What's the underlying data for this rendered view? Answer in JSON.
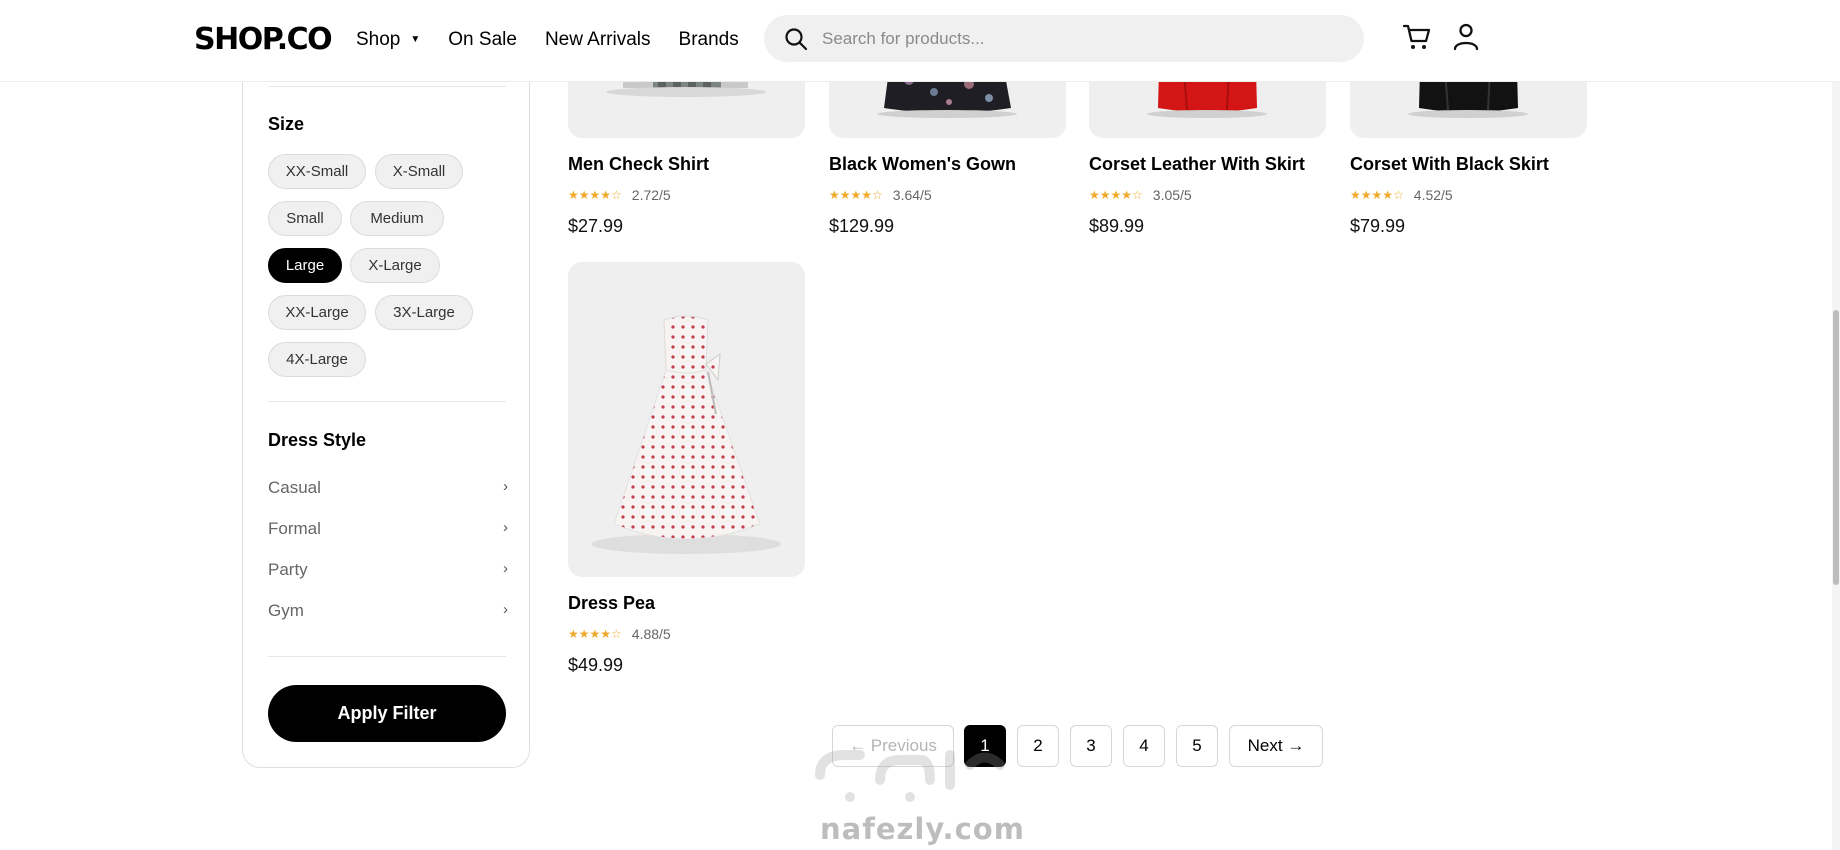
{
  "header": {
    "logo": "SHOP.CO",
    "nav": [
      {
        "label": "Shop",
        "has_dropdown": true
      },
      {
        "label": "On Sale"
      },
      {
        "label": "New Arrivals"
      },
      {
        "label": "Brands"
      }
    ],
    "search_placeholder": "Search for products..."
  },
  "filters": {
    "size_title": "Size",
    "sizes": [
      "XX-Small",
      "X-Small",
      "Small",
      "Medium",
      "Large",
      "X-Large",
      "XX-Large",
      "3X-Large",
      "4X-Large"
    ],
    "selected_size": "Large",
    "dress_style_title": "Dress Style",
    "dress_styles": [
      "Casual",
      "Formal",
      "Party",
      "Gym"
    ],
    "chevron": "›",
    "apply_label": "Apply Filter"
  },
  "products": [
    {
      "name": "Men Check Shirt",
      "rating": "2.72/5",
      "stars": "★★★★☆",
      "price": "$27.99"
    },
    {
      "name": "Black Women's Gown",
      "rating": "3.64/5",
      "stars": "★★★★☆",
      "price": "$129.99"
    },
    {
      "name": "Corset Leather With Skirt",
      "rating": "3.05/5",
      "stars": "★★★★☆",
      "price": "$89.99"
    },
    {
      "name": "Corset With Black Skirt",
      "rating": "4.52/5",
      "stars": "★★★★☆",
      "price": "$79.99"
    },
    {
      "name": "Dress Pea",
      "rating": "4.88/5",
      "stars": "★★★★☆",
      "price": "$49.99"
    }
  ],
  "pagination": {
    "previous": "← Previous",
    "pages": [
      "1",
      "2",
      "3",
      "4",
      "5"
    ],
    "current": "1",
    "next": "Next →"
  },
  "colors": {
    "accent": "#000000",
    "star": "#f0a92a",
    "chip_bg": "#f0f0f0",
    "card_bg": "#efefef"
  }
}
